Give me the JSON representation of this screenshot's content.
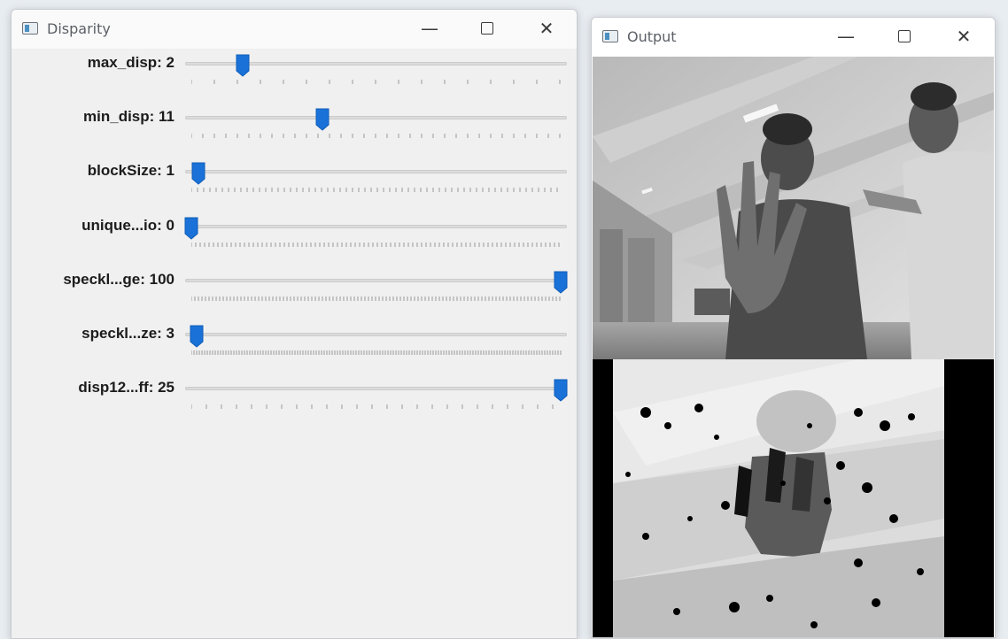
{
  "windows": {
    "disparity": {
      "title": "Disparity",
      "trackbars": [
        {
          "label": "max_disp: 2",
          "fraction": 0.14,
          "tick_spacing": 26
        },
        {
          "label": "min_disp: 11",
          "fraction": 0.355,
          "tick_spacing": 13
        },
        {
          "label": "blockSize: 1",
          "fraction": 0.02,
          "tick_spacing": 7
        },
        {
          "label": "unique...io: 0",
          "fraction": 0.0,
          "tick_spacing": 5
        },
        {
          "label": "speckl...ge: 100",
          "fraction": 1.0,
          "tick_spacing": 4
        },
        {
          "label": "speckl...ze: 3",
          "fraction": 0.015,
          "tick_spacing": 3
        },
        {
          "label": "disp12...ff: 25",
          "fraction": 1.0,
          "tick_spacing": 17
        }
      ]
    },
    "output": {
      "title": "Output"
    }
  },
  "icons": {
    "app": "window-app-icon",
    "minimize": "minimize-icon",
    "maximize": "maximize-icon",
    "close": "close-icon",
    "handle": "slider-handle-icon"
  },
  "colors": {
    "handle": "#1a72d8",
    "groove": "#dcdcdc",
    "window_bg": "#f0f0f0"
  }
}
